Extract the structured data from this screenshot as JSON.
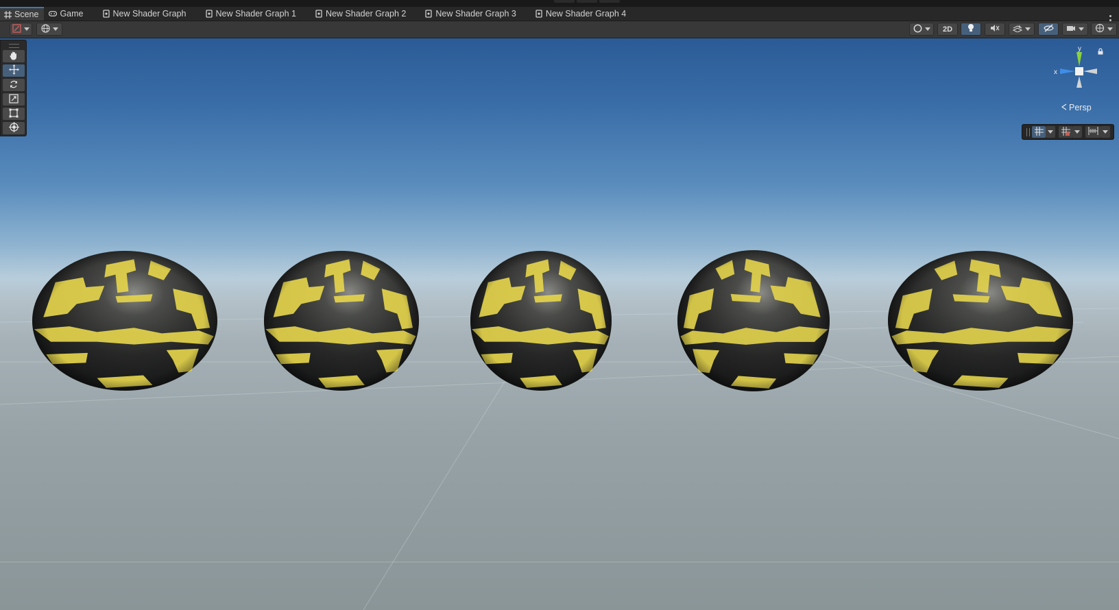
{
  "tabs": [
    {
      "label": "Scene",
      "icon": "grid-icon",
      "active": true
    },
    {
      "label": "Game",
      "icon": "gamepad-icon",
      "active": false
    },
    {
      "label": "New Shader Graph",
      "icon": "shader-graph-icon",
      "active": false
    },
    {
      "label": "New Shader Graph 1",
      "icon": "shader-graph-icon",
      "active": false
    },
    {
      "label": "New Shader Graph 2",
      "icon": "shader-graph-icon",
      "active": false
    },
    {
      "label": "New Shader Graph 3",
      "icon": "shader-graph-icon",
      "active": false
    },
    {
      "label": "New Shader Graph 4",
      "icon": "shader-graph-icon",
      "active": false
    }
  ],
  "toolbar": {
    "two_d_label": "2D",
    "lighting_on": true,
    "visibility_on": true
  },
  "tools": [
    {
      "name": "hand-tool",
      "active": false
    },
    {
      "name": "move-tool",
      "active": true
    },
    {
      "name": "rotate-tool",
      "active": false
    },
    {
      "name": "scale-tool",
      "active": false
    },
    {
      "name": "rect-tool",
      "active": false
    },
    {
      "name": "transform-tool",
      "active": false
    }
  ],
  "gizmo": {
    "y_label": "y",
    "x_label": "x",
    "projection_label": "Persp"
  },
  "scene": {
    "sphere_count": 5,
    "sphere_base_color": "#262726",
    "sphere_pattern_color": "#e6d94e",
    "sky_color": "#2b5b96",
    "ground_color": "#96a2a6"
  },
  "colors": {
    "accent": "#3a79bb",
    "active_button": "#46607c",
    "axis_x": "#e04e3e",
    "axis_y": "#8bd23d",
    "axis_z": "#3f8ee6"
  }
}
